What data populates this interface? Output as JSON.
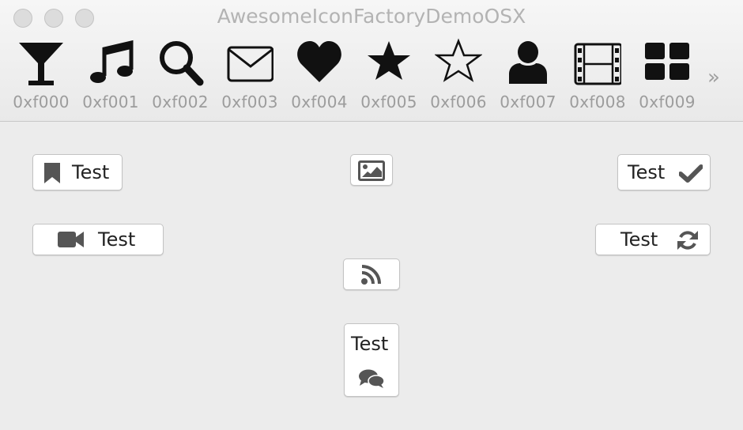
{
  "window": {
    "title": "AwesomeIconFactoryDemoOSX"
  },
  "toolbar": {
    "items": [
      {
        "icon": "glass-icon",
        "label": "0xf000"
      },
      {
        "icon": "music-icon",
        "label": "0xf001"
      },
      {
        "icon": "search-icon",
        "label": "0xf002"
      },
      {
        "icon": "envelope-icon",
        "label": "0xf003"
      },
      {
        "icon": "heart-icon",
        "label": "0xf004"
      },
      {
        "icon": "star-icon",
        "label": "0xf005"
      },
      {
        "icon": "star-outline-icon",
        "label": "0xf006"
      },
      {
        "icon": "user-icon",
        "label": "0xf007"
      },
      {
        "icon": "film-icon",
        "label": "0xf008"
      },
      {
        "icon": "th-large-icon",
        "label": "0xf009"
      }
    ],
    "overflow_label": "»"
  },
  "buttons": {
    "bookmark_label": "Test",
    "check_label": "Test",
    "video_label": "Test",
    "refresh_label": "Test",
    "comments_label": "Test"
  },
  "colors": {
    "icon": "#111111",
    "button_icon": "#555555",
    "background": "#ececec"
  }
}
